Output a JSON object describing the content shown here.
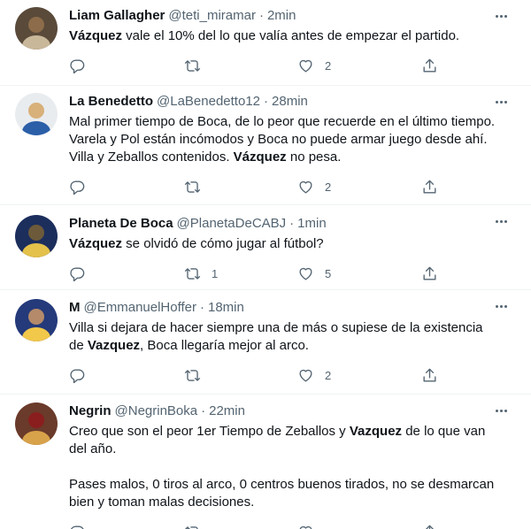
{
  "tweets": [
    {
      "name": "Liam Gallagher",
      "handle": "@teti_miramar",
      "separator": "·",
      "time": "2min",
      "paragraphs": [
        [
          {
            "b": "Vázquez"
          },
          {
            "t": " vale el 10% del lo que valía antes de empezar el partido."
          }
        ]
      ],
      "retweets": "",
      "likes": "2",
      "avatar_colors": [
        "#5a4a3a",
        "#c9b79a",
        "#8c6c4a"
      ]
    },
    {
      "name": "La Benedetto",
      "handle": "@LaBenedetto12",
      "separator": "·",
      "time": "28min",
      "paragraphs": [
        [
          {
            "t": "Mal primer tiempo de Boca, de lo peor que recuerde en el último tiempo. Varela y Pol están incómodos y Boca no puede armar juego desde ahí. Villa y Zeballos contenidos. "
          },
          {
            "b": "Vázquez"
          },
          {
            "t": " no pesa."
          }
        ]
      ],
      "retweets": "",
      "likes": "2",
      "avatar_colors": [
        "#e9ecef",
        "#2b5fa8",
        "#d8b07a"
      ]
    },
    {
      "name": "Planeta De Boca",
      "handle": "@PlanetaDeCABJ",
      "separator": "·",
      "time": "1min",
      "paragraphs": [
        [
          {
            "b": "Vázquez"
          },
          {
            "t": " se olvidó de cómo jugar al fútbol?"
          }
        ]
      ],
      "retweets": "1",
      "likes": "5",
      "avatar_colors": [
        "#1c2e5c",
        "#e3c14a",
        "#6c5a3a"
      ]
    },
    {
      "name": "M",
      "handle": "@EmmanuelHoffer",
      "separator": "·",
      "time": "18min",
      "paragraphs": [
        [
          {
            "t": "Villa si dejara de hacer siempre una de más o supiese de la existencia de "
          },
          {
            "b": "Vazquez"
          },
          {
            "t": ", Boca llegaría mejor al arco."
          }
        ]
      ],
      "retweets": "",
      "likes": "2",
      "avatar_colors": [
        "#243a7a",
        "#f2c84a",
        "#b48a6a"
      ]
    },
    {
      "name": "Negrin",
      "handle": "@NegrinBoka",
      "separator": "·",
      "time": "22min",
      "paragraphs": [
        [
          {
            "t": "Creo que son el peor 1er Tiempo de Zeballos y "
          },
          {
            "b": "Vazquez"
          },
          {
            "t": " de lo que van del año."
          }
        ],
        [
          {
            "t": "Pases malos, 0 tiros al arco, 0 centros buenos tirados, no se desmarcan bien y toman malas decisiones."
          }
        ]
      ],
      "retweets": "",
      "likes": "",
      "avatar_colors": [
        "#6a3a2a",
        "#d8a24a",
        "#8a1e1e"
      ]
    }
  ]
}
